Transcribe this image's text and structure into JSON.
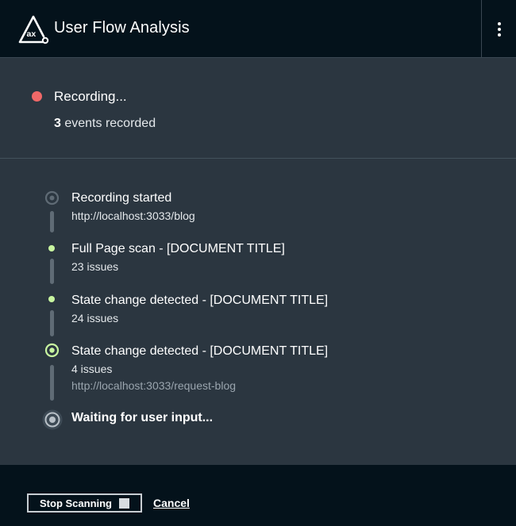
{
  "header": {
    "logo_icon": "axe-logo-icon",
    "logo_text": "ax",
    "title": "User Flow Analysis",
    "menu_icon": "kebab-menu-icon"
  },
  "status": {
    "recording_label": "Recording...",
    "recording_color": "#f06868",
    "events_count": "3",
    "events_suffix": " events recorded"
  },
  "timeline": {
    "items": [
      {
        "title": "Recording started",
        "sub": "http://localhost:3033/blog",
        "marker": "ring-dim"
      },
      {
        "title": "Full Page scan - [DOCUMENT TITLE]",
        "sub": "23 issues",
        "marker": "dot-green"
      },
      {
        "title": "State change detected - [DOCUMENT TITLE]",
        "sub": "24 issues",
        "marker": "dot-green"
      },
      {
        "title": "State change detected - [DOCUMENT TITLE]",
        "sub": "4 issues",
        "url": "http://localhost:3033/request-blog",
        "marker": "ring-green"
      },
      {
        "title": "Waiting for user input...",
        "marker": "ring-active"
      }
    ]
  },
  "footer": {
    "stop_label": "Stop Scanning",
    "cancel_label": "Cancel"
  },
  "colors": {
    "accent_green": "#c8f5a0",
    "header_bg": "#04121b",
    "panel_bg": "#2b3640"
  }
}
